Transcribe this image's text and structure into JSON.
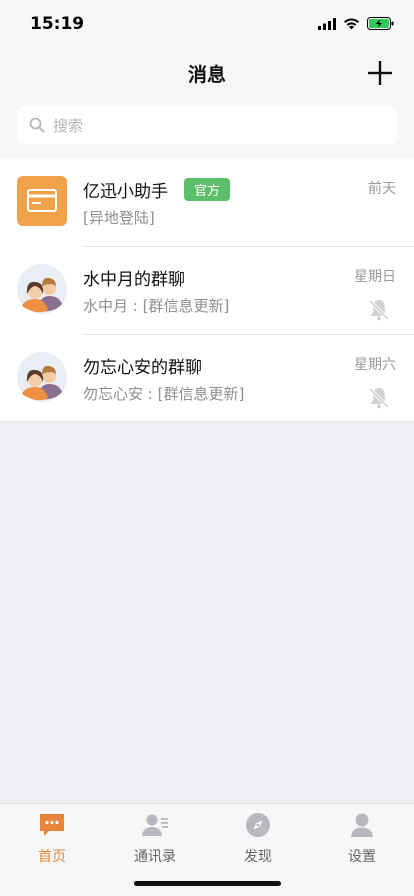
{
  "status": {
    "time": "15:19"
  },
  "nav": {
    "title": "消息"
  },
  "search": {
    "placeholder": "搜索"
  },
  "conversations": [
    {
      "title": "亿迅小助手",
      "badge": "官方",
      "subtitle": "[异地登陆]",
      "time": "前天",
      "avatar_icon": "card-icon",
      "muted": false
    },
    {
      "title": "水中月的群聊",
      "subtitle": "水中月 : [群信息更新]",
      "time": "星期日",
      "avatar_icon": "group-avatar-icon",
      "muted": true
    },
    {
      "title": "勿忘心安的群聊",
      "subtitle": "勿忘心安 : [群信息更新]",
      "time": "星期六",
      "avatar_icon": "group-avatar-icon",
      "muted": true
    }
  ],
  "tabs": [
    {
      "label": "首页",
      "icon": "chat-icon",
      "active": true
    },
    {
      "label": "通讯录",
      "icon": "contacts-icon",
      "active": false
    },
    {
      "label": "发现",
      "icon": "compass-icon",
      "active": false
    },
    {
      "label": "设置",
      "icon": "person-icon",
      "active": false
    }
  ],
  "colors": {
    "accent": "#e8853a",
    "badge": "#5cbf6a",
    "background": "#efeff4",
    "battery": "#34c759"
  }
}
